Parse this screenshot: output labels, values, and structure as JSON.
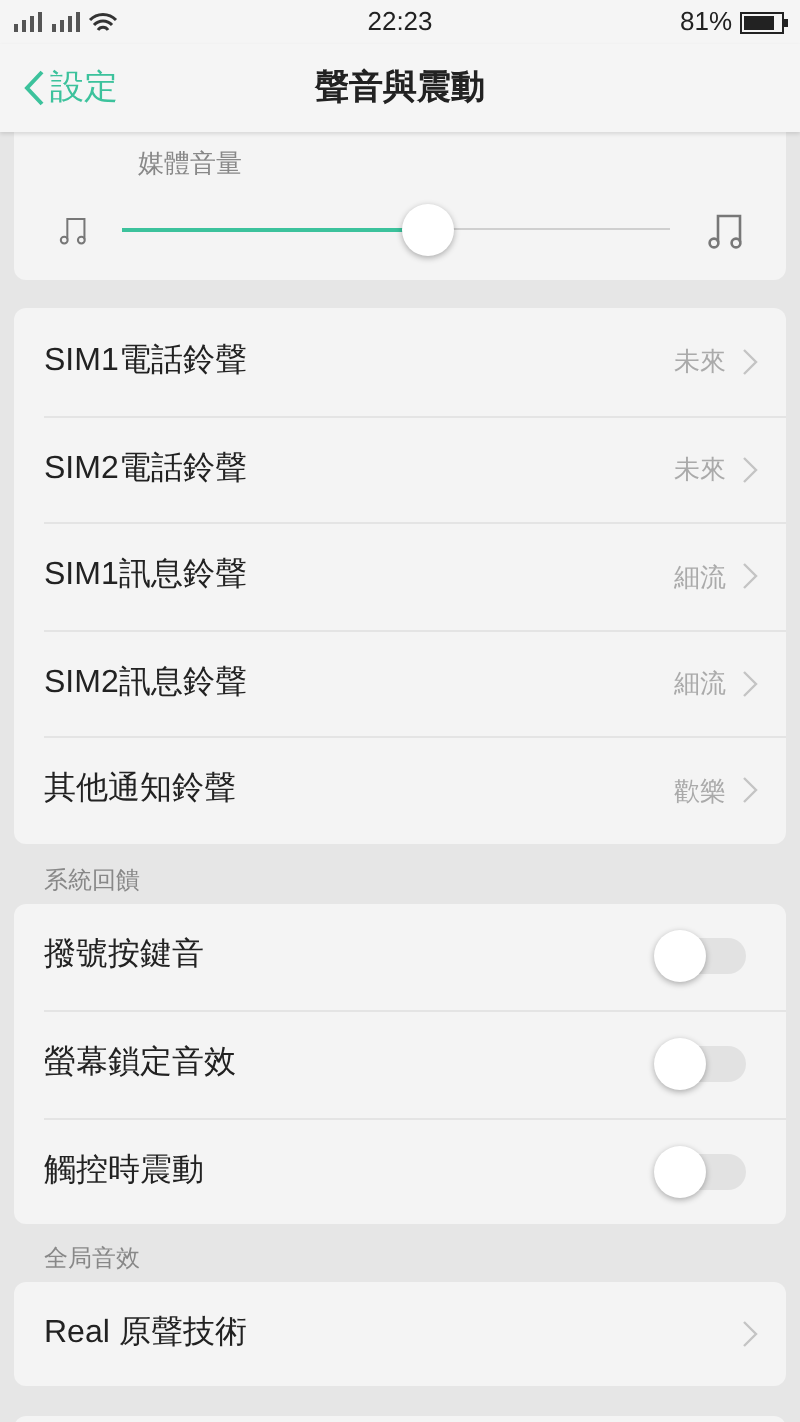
{
  "status_bar": {
    "time": "22:23",
    "battery": "81%"
  },
  "header": {
    "back": "設定",
    "title": "聲音與震動"
  },
  "media_volume": {
    "label": "媒體音量",
    "level": 0.56
  },
  "ringtones": [
    {
      "label": "SIM1電話鈴聲",
      "value": "未來"
    },
    {
      "label": "SIM2電話鈴聲",
      "value": "未來"
    },
    {
      "label": "SIM1訊息鈴聲",
      "value": "細流"
    },
    {
      "label": "SIM2訊息鈴聲",
      "value": "細流"
    },
    {
      "label": "其他通知鈴聲",
      "value": "歡樂"
    }
  ],
  "feedback": {
    "heading": "系統回饋",
    "items": [
      {
        "label": "撥號按鍵音",
        "on": false
      },
      {
        "label": "螢幕鎖定音效",
        "on": false
      },
      {
        "label": "觸控時震動",
        "on": false
      }
    ]
  },
  "global_effects": {
    "heading": "全局音效",
    "items": [
      {
        "label": "Real 原聲技術"
      }
    ]
  }
}
